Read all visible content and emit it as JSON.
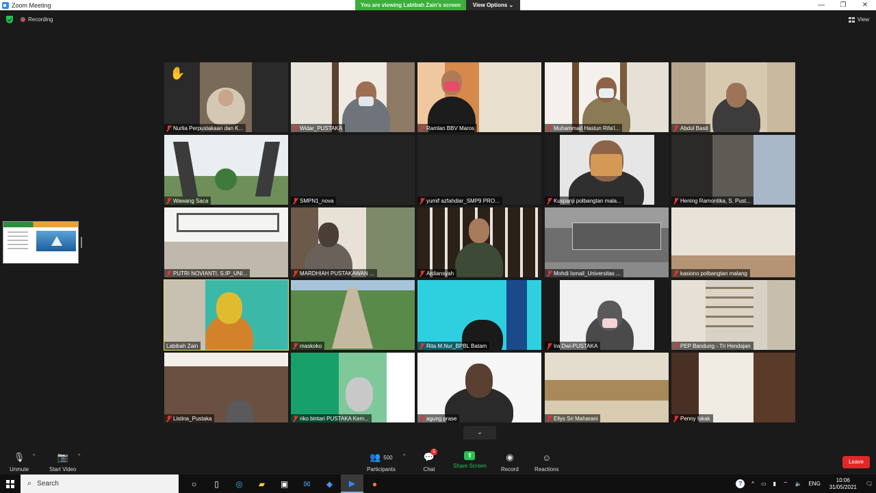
{
  "window": {
    "title": "Zoom Meeting",
    "minimize": "—",
    "restore": "❐",
    "close": "✕"
  },
  "banner": {
    "viewing_text": "You are viewing Labibah Zain's screen",
    "view_options": "View Options ⌄"
  },
  "meeting_top": {
    "recording_label": "Recording",
    "view_label": "View"
  },
  "participants": [
    {
      "name": "Nurlia Perpustakaan dan K..."
    },
    {
      "name": "Widar_PUSTAKA"
    },
    {
      "name": "Ramlan BBV Maros"
    },
    {
      "name": "Muhammad Hastun Rifa'i..."
    },
    {
      "name": "Abdul Basit"
    },
    {
      "name": "Wawang Saca"
    },
    {
      "name": "SMPN1_nova"
    },
    {
      "name": "yumif azfahdiar_SMP9 PRO..."
    },
    {
      "name": "Kuspanji polbangtan mala..."
    },
    {
      "name": "Hening Ramontika, S. Pust..."
    },
    {
      "name": "PUTRI NOVIANTI, S.IP_UNI..."
    },
    {
      "name": "MARDHIAH PUSTAKAWAN ..."
    },
    {
      "name": "Ardiansyah"
    },
    {
      "name": "Mohdi Ismail_Universitas ..."
    },
    {
      "name": "kasiono polbangtan malang"
    },
    {
      "name": "Labibah Zain"
    },
    {
      "name": "maskoko"
    },
    {
      "name": "Rita M.Nur_BPBL Batam"
    },
    {
      "name": "Ira Dwi-PUSTAKA"
    },
    {
      "name": "PEP Bandung - Tri Hendajan"
    },
    {
      "name": "Listina_Pustaka"
    },
    {
      "name": "riko bintari PUSTAKA Kem..."
    },
    {
      "name": "agung prase"
    },
    {
      "name": "Ellys Sri Maharani"
    },
    {
      "name": "Penny Iskak"
    }
  ],
  "toolbar": {
    "unmute": "Unmute",
    "start_video": "Start Video",
    "participants": "Participants",
    "participants_count": "500",
    "chat": "Chat",
    "chat_badge": "5",
    "share_screen": "Share Screen",
    "record": "Record",
    "reactions": "Reactions",
    "leave": "Leave"
  },
  "taskbar": {
    "search_placeholder": "Search",
    "lang": "ENG",
    "time": "10:06",
    "date": "31/05/2021"
  },
  "colors": {
    "accent_green": "#23c552",
    "leave_red": "#e02828",
    "active_speaker": "#e6e64a"
  }
}
